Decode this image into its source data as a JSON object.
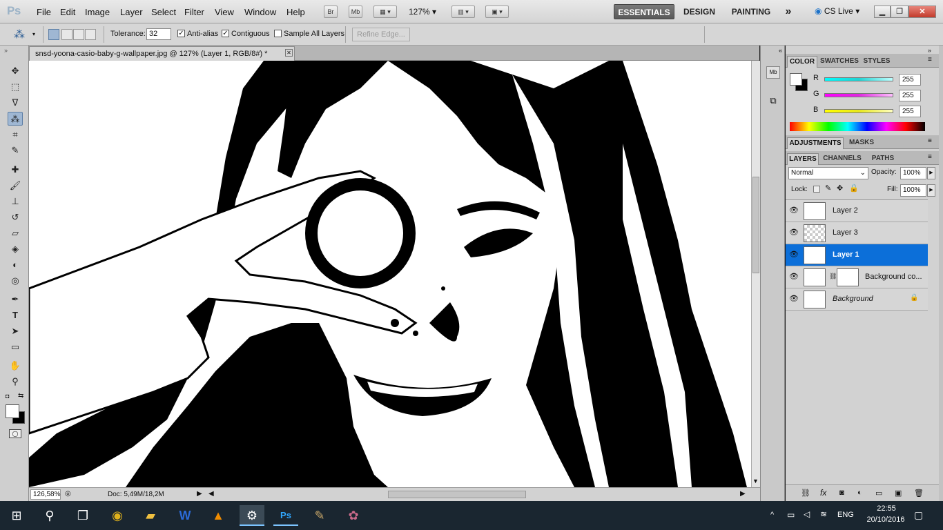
{
  "app": {
    "logo": "Ps"
  },
  "menu": [
    "File",
    "Edit",
    "Image",
    "Layer",
    "Select",
    "Filter",
    "View",
    "Window",
    "Help"
  ],
  "toolbar_buttons": {
    "bridge": "Br",
    "minibridge": "Mb",
    "zoom": "127%"
  },
  "workspaces": {
    "essentials": "ESSENTIALS",
    "design": "DESIGN",
    "painting": "PAINTING",
    "more": "»",
    "cslive": "CS Live"
  },
  "options": {
    "tolerance_label": "Tolerance:",
    "tolerance_value": "32",
    "antialias_label": "Anti-alias",
    "contiguous_label": "Contiguous",
    "sample_all_label": "Sample All Layers",
    "refine_edge_label": "Refine Edge..."
  },
  "document": {
    "tab_title": "snsd-yoona-casio-baby-g-wallpaper.jpg @ 127% (Layer 1, RGB/8#) *",
    "zoom_status": "126,58%",
    "doc_size": "Doc: 5,49M/18,2M"
  },
  "color_panel": {
    "tabs": [
      "COLOR",
      "SWATCHES",
      "STYLES"
    ],
    "channels": [
      {
        "label": "R",
        "value": "255",
        "color": "#22d3d3"
      },
      {
        "label": "G",
        "value": "255",
        "color": "#e028e0"
      },
      {
        "label": "B",
        "value": "255",
        "color": "#e8e81c"
      }
    ]
  },
  "adjust_panel": {
    "tabs": [
      "ADJUSTMENTS",
      "MASKS"
    ]
  },
  "layers_panel": {
    "tabs": [
      "LAYERS",
      "CHANNELS",
      "PATHS"
    ],
    "blend_mode": "Normal",
    "opacity_label": "Opacity:",
    "opacity_value": "100%",
    "lock_label": "Lock:",
    "fill_label": "Fill:",
    "fill_value": "100%",
    "layers": [
      {
        "name": "Layer 2",
        "selected": false
      },
      {
        "name": "Layer 3",
        "selected": false
      },
      {
        "name": "Layer 1",
        "selected": true
      },
      {
        "name": "Background co...",
        "selected": false
      },
      {
        "name": "Background",
        "selected": false
      }
    ]
  },
  "taskbar": {
    "language": "ENG",
    "time": "22:55",
    "date": "20/10/2016"
  }
}
